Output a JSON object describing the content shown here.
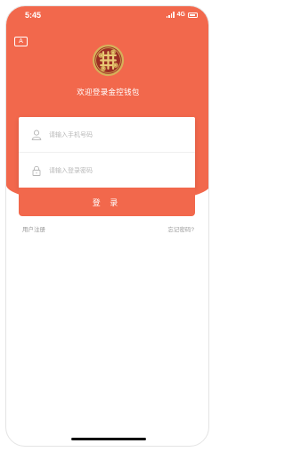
{
  "status_bar": {
    "time": "5:45",
    "network": "4G",
    "icons": [
      "signal-icon",
      "battery-icon"
    ]
  },
  "header": {
    "lang_button": "A",
    "logo_icon": "knot-logo",
    "welcome": "欢迎登录金控钱包"
  },
  "form": {
    "phone_placeholder": "请输入手机号码",
    "phone_value": "",
    "password_placeholder": "请输入登录密码",
    "password_value": "",
    "login_label": "登 录"
  },
  "links": {
    "register": "用户注册",
    "forgot": "忘记密码?"
  },
  "colors": {
    "accent": "#f2684c",
    "logo_gold": "#d6b05a",
    "logo_red": "#9b2e24"
  }
}
